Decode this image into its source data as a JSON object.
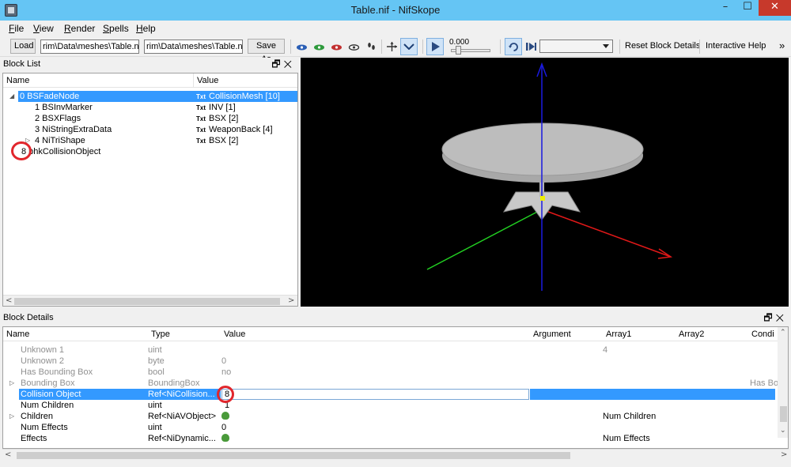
{
  "window": {
    "title": "Table.nif - NifSkope",
    "min_glyph": "–",
    "max_glyph": "☐",
    "close_glyph": "✕"
  },
  "menu": {
    "items": [
      "File",
      "View",
      "Render",
      "Spells",
      "Help"
    ]
  },
  "toolbar": {
    "load_label": "Load",
    "load_path": "rim\\Data\\meshes\\Table.nif",
    "save_path": "rim\\Data\\meshes\\Table.nif",
    "save_as_label": "Save As",
    "time_value": "0.000",
    "reset_label": "Reset Block Details",
    "help_label": "Interactive Help",
    "overflow_glyph": "»"
  },
  "block_list": {
    "title": "Block List",
    "columns": {
      "name": "Name",
      "value": "Value"
    },
    "tag": "Txt",
    "rows": [
      {
        "name": "0 BSFadeNode",
        "value": "CollisionMesh [10]"
      },
      {
        "name": "1 BSInvMarker",
        "value": "INV [1]"
      },
      {
        "name": "2 BSXFlags",
        "value": "BSX [2]"
      },
      {
        "name": "3 NiStringExtraData",
        "value": "WeaponBack [4]"
      },
      {
        "name": "4 NiTriShape",
        "value": "BSX [2]"
      },
      {
        "name": "8 bhkCollisionObject",
        "value": ""
      }
    ]
  },
  "block_details": {
    "title": "Block Details",
    "columns": {
      "name": "Name",
      "type": "Type",
      "value": "Value",
      "argument": "Argument",
      "array1": "Array1",
      "array2": "Array2",
      "cond": "Condi"
    },
    "rows": [
      {
        "name": "Unknown 1",
        "type": "uint",
        "value": "",
        "array1": "4",
        "cond": ""
      },
      {
        "name": "Unknown 2",
        "type": "byte",
        "value": "0",
        "array1": "",
        "cond": ""
      },
      {
        "name": "Has Bounding Box",
        "type": "bool",
        "value": "no",
        "array1": "",
        "cond": ""
      },
      {
        "name": "Bounding Box",
        "type": "BoundingBox",
        "value": "",
        "array1": "",
        "cond": "Has Bo"
      },
      {
        "name": "Collision Object",
        "type": "Ref<NiCollision...",
        "value": "8",
        "array1": "",
        "cond": ""
      },
      {
        "name": "Num Children",
        "type": "uint",
        "value": "1",
        "array1": "",
        "cond": ""
      },
      {
        "name": "Children",
        "type": "Ref<NiAVObject>",
        "value": "",
        "array1": "Num Children",
        "cond": ""
      },
      {
        "name": "Num Effects",
        "type": "uint",
        "value": "0",
        "array1": "",
        "cond": ""
      },
      {
        "name": "Effects",
        "type": "Ref<NiDynamic...",
        "value": "",
        "array1": "Num Effects",
        "cond": ""
      }
    ]
  },
  "colors": {
    "selection": "#3399ff",
    "title_bar": "#65c5f4",
    "close": "#c7392b",
    "annotation": "#e1262c"
  }
}
